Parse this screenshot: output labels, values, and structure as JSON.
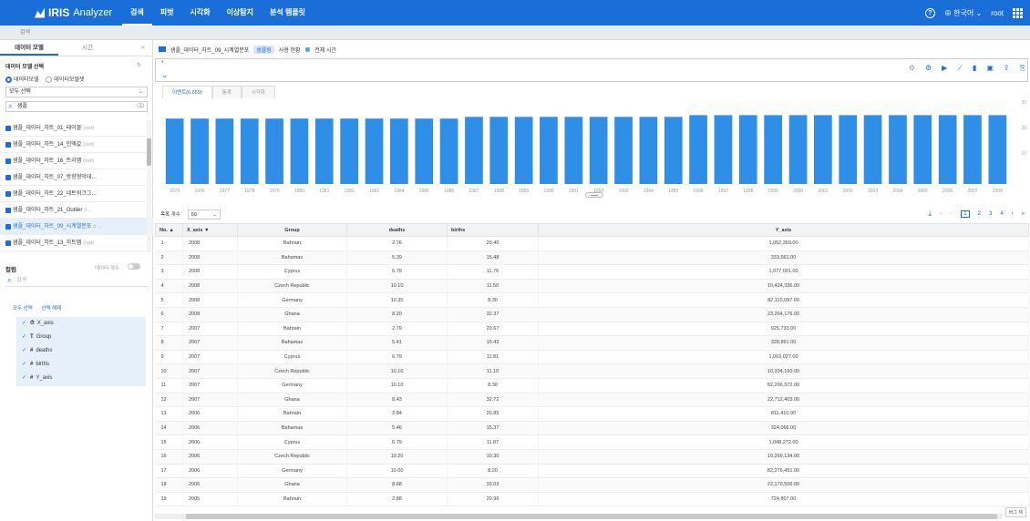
{
  "app": {
    "name": "IRIS",
    "sub": "Analyzer"
  },
  "nav": [
    {
      "label": "검색",
      "active": true
    },
    {
      "label": "피벗",
      "active": false
    },
    {
      "label": "시각화",
      "active": false
    },
    {
      "label": "이상탐지",
      "active": false
    },
    {
      "label": "분석 템플릿",
      "active": false
    }
  ],
  "topright": {
    "help": "?",
    "language": "한국어",
    "user": "root"
  },
  "breadcrumb": "검색",
  "sidebar": {
    "tabs": [
      "데이터 모델",
      "시간"
    ],
    "collapse": "«",
    "section_title": "데이터 모델 선택",
    "radios": [
      "데이터모델",
      "데이터모델셋"
    ],
    "select_all": "모두 선택",
    "search_value": "샘플",
    "search_clear": "⌫",
    "models": [
      {
        "label": "샘플_데이터_차트_01_테이블",
        "tag": "(root)",
        "selected": false
      },
      {
        "label": "샘플_데이터_차트_14_인덱값",
        "tag": "(root)",
        "selected": false
      },
      {
        "label": "샘플_데이터_차트_16_트리맵",
        "tag": "(root)",
        "selected": false
      },
      {
        "label": "샘플_데이터_차트_07_방향형막대…",
        "tag": "",
        "selected": false
      },
      {
        "label": "샘플_데이터_차트_22_네트워크그…",
        "tag": "",
        "selected": false
      },
      {
        "label": "샘플_데이터_차트_21_Outlier",
        "tag": "(r…",
        "selected": false
      },
      {
        "label": "샘플_데이터_차트_09_시계열분포",
        "tag": "(r…",
        "selected": true
      },
      {
        "label": "샘플_데이터_차트_13_히트맵",
        "tag": "(root)",
        "selected": false
      }
    ],
    "columns_title": "컬럼",
    "toggle_label": "데이터 개수",
    "columns_search_placeholder": "검색",
    "col_links": [
      "모두 선택",
      "선택 해제"
    ],
    "columns": [
      {
        "type": "⏱",
        "name": "X_axis"
      },
      {
        "type": "T",
        "name": "Group"
      },
      {
        "type": "#",
        "name": "deaths"
      },
      {
        "type": "#",
        "name": "births"
      },
      {
        "type": "#",
        "name": "Y_axis"
      }
    ]
  },
  "main": {
    "model_title": "샘플_데이터_차트_09_시계열분포",
    "badge": "샘플링",
    "usage": "사용 현황",
    "time_range": "전체 시간",
    "query": "*",
    "tabs": [
      "이벤트(6,659)",
      "통계",
      "시각화"
    ],
    "page_size_label": "목록 개수",
    "page_size": "50",
    "pages": [
      "1",
      "2",
      "3",
      "4"
    ],
    "table": {
      "headers": [
        "No. ▲",
        "X_axis ▼",
        "Group",
        "deaths",
        "births",
        "Y_axis"
      ],
      "rows": [
        [
          "1",
          "2008",
          "Bahrain",
          "2.76",
          "20.40",
          "1,052,359.00"
        ],
        [
          "2",
          "2008",
          "Bahamas",
          "5.39",
          "15.48",
          "333,661.00"
        ],
        [
          "3",
          "2008",
          "Cyprus",
          "6.79",
          "11.76",
          "1,077,001.00"
        ],
        [
          "4",
          "2008",
          "Czech Republic",
          "10.10",
          "11.50",
          "10,424,336.00"
        ],
        [
          "5",
          "2008",
          "Germany",
          "10.30",
          "8.30",
          "82,110,097.00"
        ],
        [
          "6",
          "2008",
          "Ghana",
          "8.20",
          "32.37",
          "23,264,176.00"
        ],
        [
          "7",
          "2007",
          "Bahrain",
          "2.79",
          "20.67",
          "925,733.00"
        ],
        [
          "8",
          "2007",
          "Bahamas",
          "5.41",
          "15.43",
          "328,861.00"
        ],
        [
          "9",
          "2007",
          "Cyprus",
          "6.79",
          "11.81",
          "1,063,027.00"
        ],
        [
          "10",
          "2007",
          "Czech Republic",
          "10.10",
          "11.10",
          "10,334,160.00"
        ],
        [
          "11",
          "2007",
          "Germany",
          "10.10",
          "8.30",
          "82,266,372.00"
        ],
        [
          "12",
          "2007",
          "Ghana",
          "8.43",
          "32.72",
          "22,712,403.00"
        ],
        [
          "13",
          "2006",
          "Bahrain",
          "2.84",
          "20.85",
          "811,410.00"
        ],
        [
          "14",
          "2006",
          "Bahamas",
          "5.46",
          "15.37",
          "324,066.00"
        ],
        [
          "15",
          "2006",
          "Cyprus",
          "6.79",
          "11.87",
          "1,048,272.00"
        ],
        [
          "16",
          "2006",
          "Czech Republic",
          "10.20",
          "10.30",
          "10,269,134.00"
        ],
        [
          "17",
          "2006",
          "Germany",
          "10.00",
          "8.20",
          "82,376,451.00"
        ],
        [
          "18",
          "2006",
          "Ghana",
          "8.68",
          "33.03",
          "22,170,556.00"
        ],
        [
          "19",
          "2005",
          "Bahrain",
          "2.88",
          "20.96",
          "724,807.00"
        ]
      ]
    },
    "corner_badge": "버그 제"
  },
  "chart_data": {
    "type": "bar",
    "categories": [
      "1975",
      "1976",
      "1977",
      "1978",
      "1979",
      "1980",
      "1981",
      "1982",
      "1983",
      "1984",
      "1985",
      "1986",
      "1987",
      "1988",
      "1989",
      "1990",
      "1991",
      "1992",
      "1993",
      "1994",
      "1995",
      "1996",
      "1997",
      "1998",
      "1999",
      "2000",
      "2001",
      "2002",
      "2003",
      "2004",
      "2005",
      "2006",
      "2007",
      "2008"
    ],
    "values": [
      190,
      190,
      190,
      190,
      190,
      190,
      190,
      190,
      190,
      190,
      190,
      190,
      195,
      195,
      195,
      195,
      195,
      195,
      195,
      195,
      195,
      200,
      200,
      200,
      200,
      200,
      200,
      200,
      200,
      200,
      200,
      200,
      200,
      200
    ],
    "ylim": [
      0,
      300
    ],
    "yticks": [
      "30",
      "20",
      "10"
    ],
    "color": "#2f8ee5"
  }
}
